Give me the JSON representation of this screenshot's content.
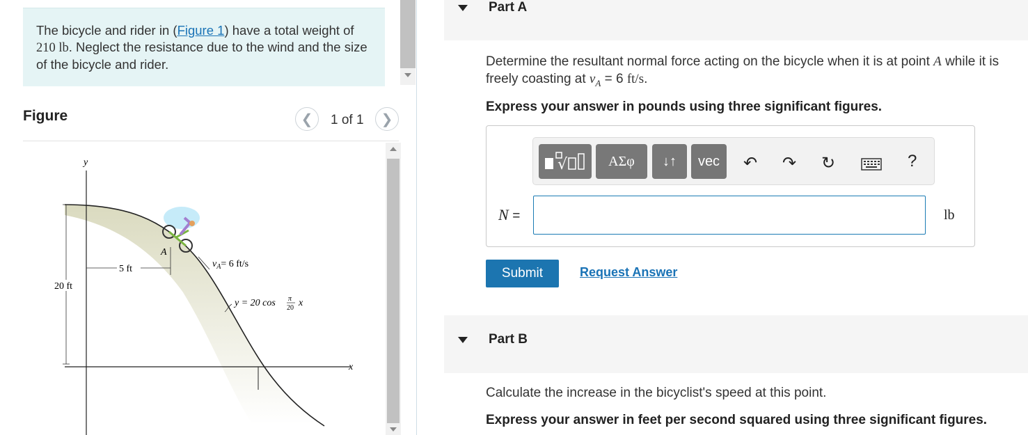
{
  "problem": {
    "text_before_link": "The bicycle and rider in (",
    "figure_link": "Figure 1",
    "text_after_link": ") have a total weight of",
    "weight": "210 lb",
    "text_end": ". Neglect the resistance due to the wind and the size of the bicycle and rider."
  },
  "figure_panel": {
    "heading": "Figure",
    "counter": "1 of 1",
    "prev_icon": "chevron-left-icon",
    "next_icon": "chevron-right-icon",
    "diagram": {
      "y_axis": "y",
      "x_axis": "x",
      "height_dim": "20 ft",
      "offset_dim": "5 ft",
      "point": "A",
      "velocity_label": "v",
      "velocity_sub": "A",
      "velocity_value": "= 6 ft/s",
      "curve_eq_prefix": "y = 20 cos",
      "curve_frac_num": "π",
      "curve_frac_den": "20",
      "curve_eq_suffix": "x"
    }
  },
  "part_a": {
    "title": "Part A",
    "question_prefix": "Determine the resultant normal force acting on the bicycle when it is at point",
    "question_point": "A",
    "question_mid": "while it is freely coasting at",
    "question_v": "v",
    "question_v_sub": "A",
    "question_eq": "= 6",
    "question_unit": "ft/s",
    "question_end": ".",
    "instruction": "Express your answer in pounds using three significant figures.",
    "toolbar": {
      "templates_icon": "templates-icon",
      "greek_label": "ΑΣφ",
      "arrows_label": "↓↑",
      "vec_label": "vec",
      "undo_icon": "undo-icon",
      "redo_icon": "redo-icon",
      "reset_icon": "reset-icon",
      "keyboard_icon": "keyboard-icon",
      "help_label": "?"
    },
    "answer_label": "N",
    "answer_eq": "=",
    "answer_value": "",
    "unit": "lb",
    "submit_label": "Submit",
    "request_label": "Request Answer"
  },
  "part_b": {
    "title": "Part B",
    "question": "Calculate the increase in the bicyclist's speed at this point.",
    "instruction": "Express your answer in feet per second squared using three significant figures."
  }
}
